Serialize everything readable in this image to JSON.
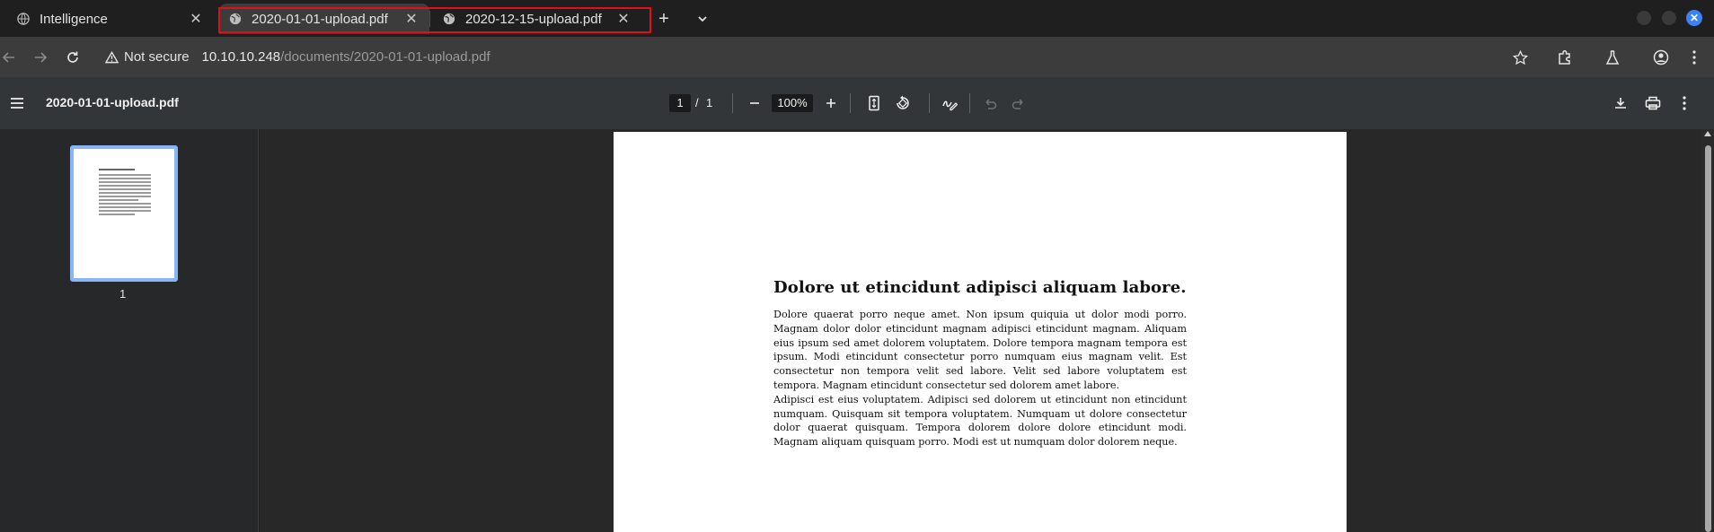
{
  "tabs": [
    {
      "title": "Intelligence",
      "icon": "globe-icon"
    },
    {
      "title": "2020-01-01-upload.pdf",
      "icon": "globe-icon"
    },
    {
      "title": "2020-12-15-upload.pdf",
      "icon": "globe-icon"
    }
  ],
  "address": {
    "security_text": "Not secure",
    "host": "10.10.10.248",
    "path": "/documents/2020-01-01-upload.pdf"
  },
  "pdf_toolbar": {
    "title": "2020-01-01-upload.pdf",
    "current_page": "1",
    "separator": "/",
    "total_pages": "1",
    "zoom": "100%"
  },
  "sidebar": {
    "thumbnail_label": "1"
  },
  "document": {
    "heading": "Dolore ut etincidunt adipisci aliquam labore.",
    "paragraph1": "Dolore quaerat porro neque amet. Non ipsum quiquia ut dolor modi porro. Magnam dolor dolor etincidunt magnam adipisci etincidunt magnam. Aliquam eius ipsum sed amet dolorem voluptatem. Dolore tempora magnam tempora est ipsum. Modi etincidunt consectetur porro numquam eius magnam velit. Est consectetur non tempora velit sed labore. Velit sed labore voluptatem est tempora. Magnam etincidunt consectetur sed dolorem amet labore.",
    "paragraph2": "Adipisci est eius voluptatem. Adipisci sed dolorem ut etincidunt non etincidunt numquam. Quisquam sit tempora voluptatem. Numquam ut dolore consectetur dolor quaerat quisquam. Tempora dolorem dolore dolore etincidunt modi. Magnam aliquam quisquam porro. Modi est ut numquam dolor dolorem neque."
  },
  "colors": {
    "highlight_box": "#e0101a",
    "accent": "#8ab4f8",
    "window_close": "#3b82f6"
  }
}
